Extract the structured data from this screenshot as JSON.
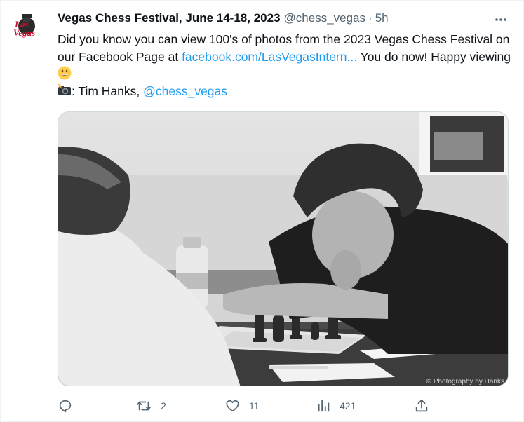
{
  "tweet": {
    "display_name": "Vegas Chess Festival, June 14-18, 2023",
    "handle": "@chess_vegas",
    "separator": "·",
    "time": "5h",
    "text_part1": "Did you know you can view 100's of photos from the 2023 Vegas Chess Festival on our Facebook Page at ",
    "link_text": "facebook.com/LasVegasIntern...",
    "text_part2": " You do now! Happy viewing ",
    "credit_label": ": Tim Hanks, ",
    "credit_mention": "@chess_vegas",
    "photo_watermark": "© Photography by Hanks"
  },
  "actions": {
    "reply_count": "",
    "retweet_count": "2",
    "like_count": "11",
    "views_count": "421"
  },
  "colors": {
    "link": "#1d9bf0",
    "muted": "#536471",
    "text": "#0f1419",
    "avatar_red": "#c8102e"
  },
  "icons": {
    "avatar": "vegas-chess-logo",
    "more": "more-icon",
    "emoji_smile": "grinning-face-emoji",
    "emoji_camera": "camera-flash-emoji",
    "reply": "reply-icon",
    "retweet": "retweet-icon",
    "like": "heart-icon",
    "views": "views-icon",
    "share": "share-icon"
  }
}
